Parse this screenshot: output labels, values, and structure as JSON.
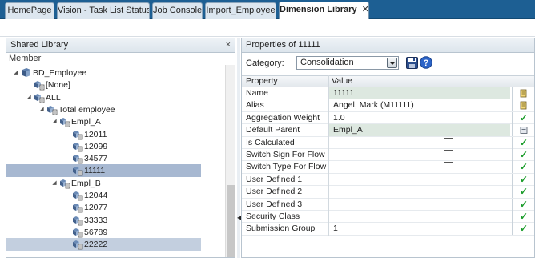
{
  "tabs": [
    {
      "label": "HomePage"
    },
    {
      "label": "Vision - Task List Status"
    },
    {
      "label": "Job Console"
    },
    {
      "label": "Import_Employee"
    },
    {
      "label": "Dimension Library",
      "close": "✕"
    }
  ],
  "left_panel": {
    "title": "Shared Library",
    "close": "×",
    "column_header": "Member",
    "tree": [
      {
        "label": "BD_Employee"
      },
      {
        "label": "[None]"
      },
      {
        "label": "ALL"
      },
      {
        "label": "Total employee"
      },
      {
        "label": "Empl_A"
      },
      {
        "label": "12011"
      },
      {
        "label": "12099"
      },
      {
        "label": "34577"
      },
      {
        "label": "11111"
      },
      {
        "label": "Empl_B"
      },
      {
        "label": "12044"
      },
      {
        "label": "12077"
      },
      {
        "label": "33333"
      },
      {
        "label": "56789"
      },
      {
        "label": "22222"
      }
    ]
  },
  "right_panel": {
    "title": "Properties of 11111",
    "category_label": "Category:",
    "category_value": "Consolidation",
    "grid_headers": {
      "property": "Property",
      "value": "Value"
    },
    "rows": [
      {
        "property": "Name",
        "value": "11111"
      },
      {
        "property": "Alias",
        "value": "Angel, Mark (M11111)"
      },
      {
        "property": "Aggregation Weight",
        "value": "1.0"
      },
      {
        "property": "Default Parent",
        "value": "Empl_A"
      },
      {
        "property": "Is Calculated",
        "value": ""
      },
      {
        "property": "Switch Sign For Flow",
        "value": ""
      },
      {
        "property": "Switch Type For Flow",
        "value": ""
      },
      {
        "property": "User Defined 1",
        "value": ""
      },
      {
        "property": "User Defined 2",
        "value": ""
      },
      {
        "property": "User Defined 3",
        "value": ""
      },
      {
        "property": "Security Class",
        "value": ""
      },
      {
        "property": "Submission Group",
        "value": "1"
      }
    ]
  }
}
